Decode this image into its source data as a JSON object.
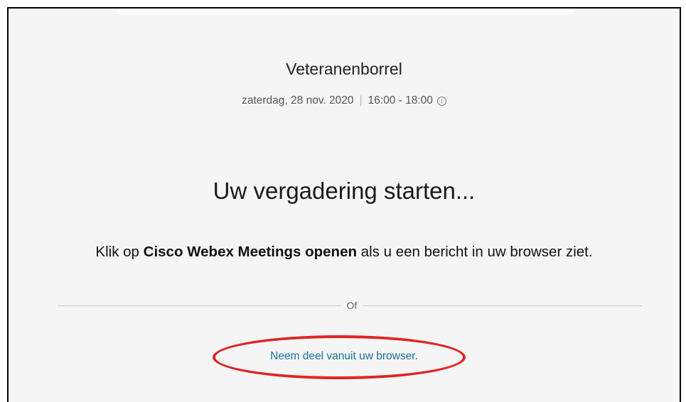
{
  "meeting": {
    "title": "Veteranenborrel",
    "date": "zaterdag, 28 nov. 2020",
    "separator": "|",
    "time": "16:00 - 18:00",
    "info_icon": "info-circle-icon"
  },
  "main": {
    "heading": "Uw vergadering starten...",
    "instruction_prefix": "Klik op ",
    "instruction_bold": "Cisco Webex Meetings openen",
    "instruction_suffix": " als u een bericht in uw browser ziet.",
    "divider_text": "Of",
    "join_link": "Neem deel vanuit uw browser."
  },
  "colors": {
    "link": "#1b6f9a",
    "annotation": "#e02424",
    "background": "#f5f5f5"
  }
}
